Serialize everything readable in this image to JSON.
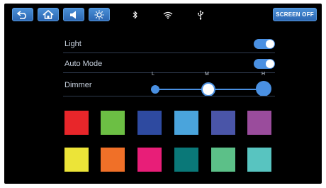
{
  "toolbar": {
    "buttons": [
      {
        "name": "back",
        "icon": "back-arrow-icon"
      },
      {
        "name": "home",
        "icon": "home-icon"
      },
      {
        "name": "volume",
        "icon": "speaker-icon"
      },
      {
        "name": "brightness",
        "icon": "sun-icon"
      }
    ],
    "status_icons": [
      "bluetooth-icon",
      "wifi-icon",
      "usb-icon"
    ],
    "screen_off_label": "SCREEN OFF"
  },
  "settings": {
    "light": {
      "label": "Light",
      "enabled": true
    },
    "auto_mode": {
      "label": "Auto Mode",
      "enabled": true
    },
    "dimmer": {
      "label": "Dimmer",
      "levels": [
        "L",
        "M",
        "H"
      ],
      "selected": "M"
    }
  },
  "colors": {
    "accent": "#4a90e2",
    "row1": [
      "#e8262a",
      "#6cbf44",
      "#2e4aa0",
      "#4aa4dc",
      "#4a55a8",
      "#9a4c9c"
    ],
    "row2": [
      "#ece438",
      "#f07028",
      "#e81e78",
      "#0a7878",
      "#5cc088",
      "#58c4c0"
    ]
  }
}
